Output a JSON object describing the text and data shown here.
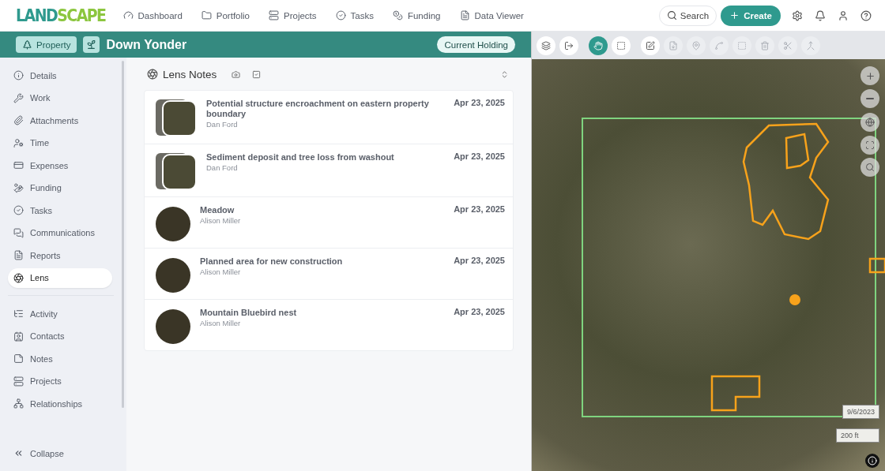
{
  "logo": [
    "LAND",
    "SCAPE"
  ],
  "nav": [
    {
      "label": "Dashboard"
    },
    {
      "label": "Portfolio"
    },
    {
      "label": "Projects"
    },
    {
      "label": "Tasks"
    },
    {
      "label": "Funding"
    },
    {
      "label": "Data Viewer"
    }
  ],
  "search": {
    "label": "Search"
  },
  "create": {
    "label": "Create"
  },
  "record": {
    "type": "Property",
    "title": "Down Yonder",
    "status": "Current Holding"
  },
  "sidebar": {
    "groups": [
      [
        {
          "label": "Details",
          "selected": false
        },
        {
          "label": "Work",
          "selected": false
        },
        {
          "label": "Attachments",
          "selected": false
        },
        {
          "label": "Time",
          "selected": false
        },
        {
          "label": "Expenses",
          "selected": false
        },
        {
          "label": "Funding",
          "selected": false
        },
        {
          "label": "Tasks",
          "selected": false
        },
        {
          "label": "Communications",
          "selected": false
        },
        {
          "label": "Reports",
          "selected": false
        },
        {
          "label": "Lens",
          "selected": true
        }
      ],
      [
        {
          "label": "Activity",
          "selected": false
        },
        {
          "label": "Contacts",
          "selected": false
        },
        {
          "label": "Notes",
          "selected": false
        },
        {
          "label": "Projects",
          "selected": false
        },
        {
          "label": "Relationships",
          "selected": false
        }
      ]
    ],
    "collapse": "Collapse"
  },
  "lens": {
    "title": "Lens Notes",
    "notes": [
      {
        "title": "Potential structure encroachment on eastern property boundary",
        "author": "Dan Ford",
        "date": "Apr 23, 2025",
        "kind": "stack"
      },
      {
        "title": "Sediment deposit and tree loss from washout",
        "author": "Dan Ford",
        "date": "Apr 23, 2025",
        "kind": "stack"
      },
      {
        "title": "Meadow",
        "author": "Alison Miller",
        "date": "Apr 23, 2025",
        "kind": "circle"
      },
      {
        "title": "Planned area for new construction",
        "author": "Alison Miller",
        "date": "Apr 23, 2025",
        "kind": "circle"
      },
      {
        "title": "Mountain Bluebird nest",
        "author": "Alison Miller",
        "date": "Apr 23, 2025",
        "kind": "circle"
      }
    ]
  },
  "map_tools": [
    {
      "selected": false,
      "disabled": false
    },
    {
      "selected": false,
      "disabled": false
    },
    {
      "selected": true,
      "disabled": false
    },
    {
      "selected": false,
      "disabled": false
    },
    {
      "selected": false,
      "disabled": false
    },
    {
      "selected": false,
      "disabled": true
    },
    {
      "selected": false,
      "disabled": true
    },
    {
      "selected": false,
      "disabled": true
    },
    {
      "selected": false,
      "disabled": true
    },
    {
      "selected": false,
      "disabled": true
    },
    {
      "selected": false,
      "disabled": true
    },
    {
      "selected": false,
      "disabled": true
    }
  ],
  "map": {
    "date": "9/6/2023",
    "scale": "200 ft"
  }
}
